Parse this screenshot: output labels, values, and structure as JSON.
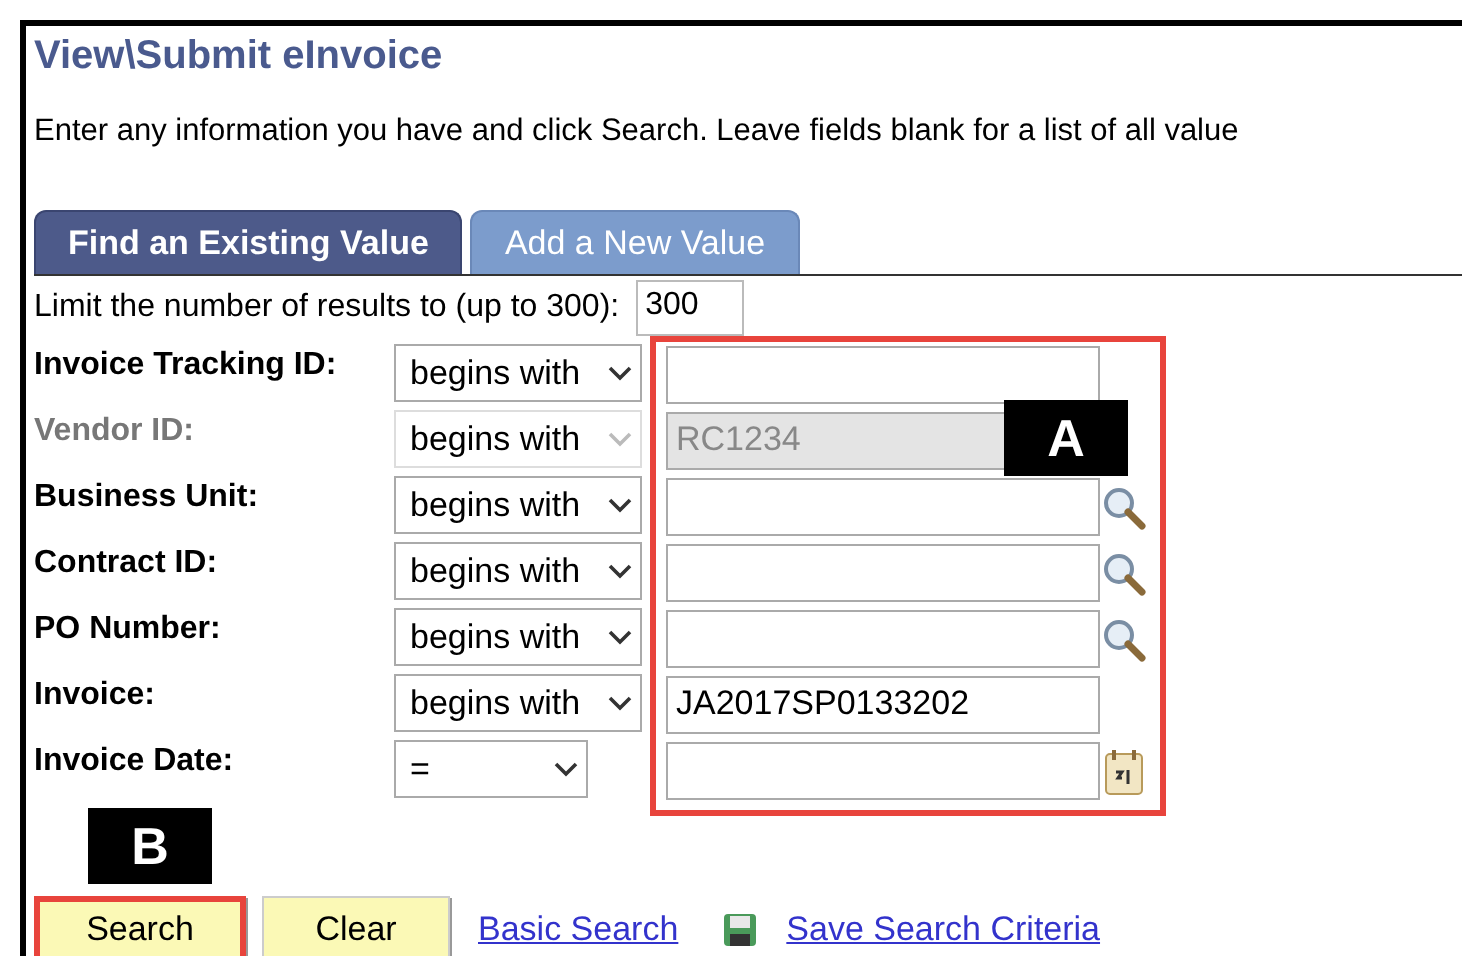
{
  "title": "View\\Submit eInvoice",
  "instructions": "Enter any information you have and click Search. Leave fields blank for a list of all value",
  "tabs": [
    {
      "label": "Find an Existing Value",
      "selected": true
    },
    {
      "label": "Add a New Value",
      "selected": false
    }
  ],
  "limit": {
    "label": "Limit the number of results to (up to 300):",
    "value": "300"
  },
  "fields": [
    {
      "label": "Invoice Tracking ID:",
      "operator": "begins with",
      "disabled": false,
      "kind": "plain"
    },
    {
      "label": "Vendor ID:",
      "operator": "begins with",
      "value": "RC1234",
      "disabled": true,
      "kind": "plain"
    },
    {
      "label": "Business Unit:",
      "operator": "begins with",
      "disabled": false,
      "kind": "lookup"
    },
    {
      "label": "Contract ID:",
      "operator": "begins with",
      "disabled": false,
      "kind": "lookup"
    },
    {
      "label": "PO Number:",
      "operator": "begins with",
      "disabled": false,
      "kind": "lookup"
    },
    {
      "label": "Invoice:",
      "operator": "begins with",
      "value": "JA2017SP0133202",
      "disabled": false,
      "kind": "plain"
    },
    {
      "label": "Invoice Date:",
      "operator": "=",
      "disabled": false,
      "kind": "date"
    }
  ],
  "callouts": [
    {
      "label": "A"
    },
    {
      "label": "B"
    }
  ],
  "actions": [
    {
      "kind": "button",
      "label": "Search",
      "highlighted": true
    },
    {
      "kind": "button",
      "label": "Clear",
      "highlighted": false
    },
    {
      "kind": "link",
      "label": "Basic Search"
    },
    {
      "kind": "save-link",
      "label": "Save Search Criteria"
    }
  ]
}
